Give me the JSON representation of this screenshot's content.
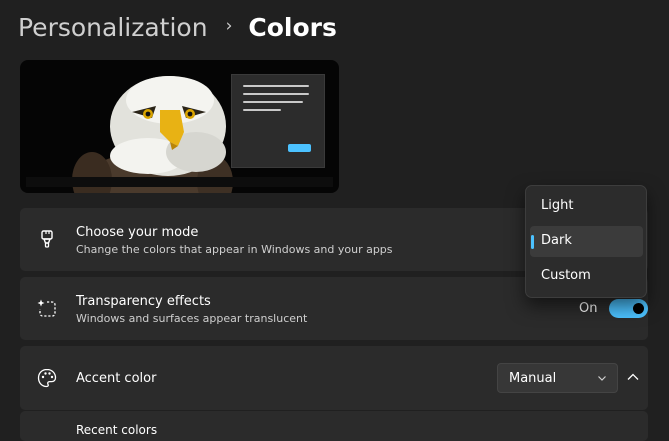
{
  "breadcrumb": {
    "parent": "Personalization",
    "separator": "›",
    "current": "Colors"
  },
  "preview": {
    "image": "bald-eagle-wallpaper"
  },
  "mode": {
    "title": "Choose your mode",
    "subtitle": "Change the colors that appear in Windows and your apps",
    "icon": "paintbrush-icon",
    "options": [
      "Light",
      "Dark",
      "Custom"
    ],
    "selected": "Dark"
  },
  "transparency": {
    "title": "Transparency effects",
    "subtitle": "Windows and surfaces appear translucent",
    "icon": "sparkle-frame-icon",
    "state_label": "On",
    "enabled": true
  },
  "accent": {
    "title": "Accent color",
    "icon": "palette-icon",
    "dropdown_value": "Manual",
    "expanded": true
  },
  "recent": {
    "label": "Recent colors"
  },
  "colors": {
    "accent": "#4cc2ff",
    "background": "#202020",
    "card": "#2b2b2b"
  }
}
